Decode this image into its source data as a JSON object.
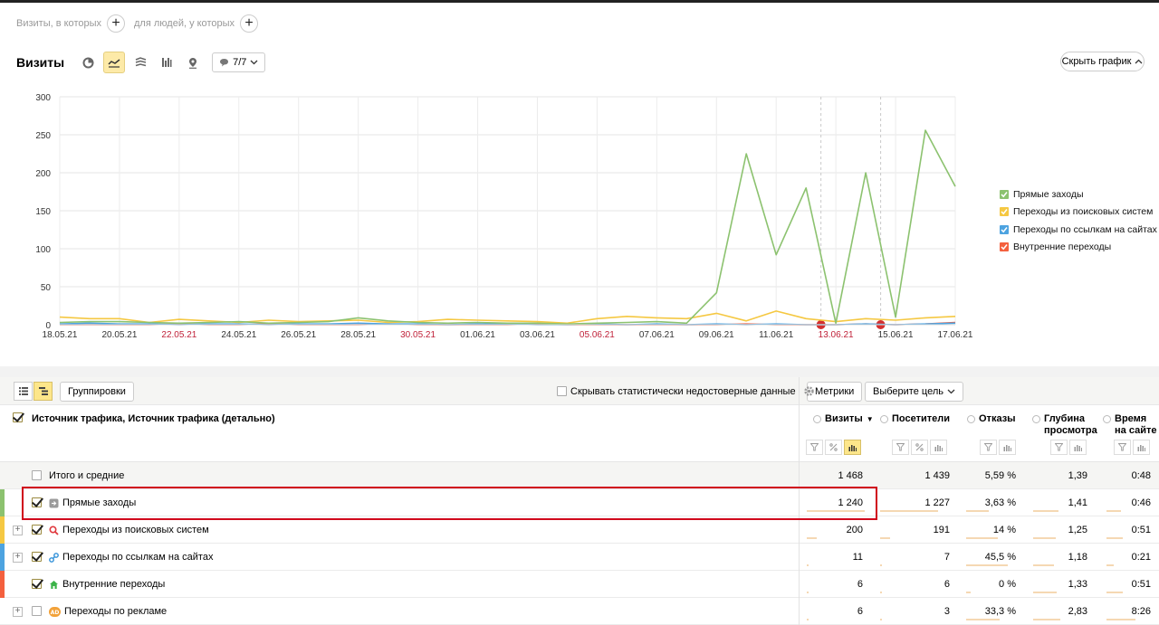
{
  "segment": {
    "visits_label": "Визиты, в которых",
    "people_label": "для людей, у которых"
  },
  "header": {
    "title": "Визиты",
    "detail_value": "7/7",
    "hide_chart_label": "Скрыть график"
  },
  "colors": {
    "direct": "#8cc26f",
    "search": "#f5c842",
    "links": "#4da3e0",
    "internal": "#f4603e",
    "ads": "#d0d0d0",
    "highlight": "#d0021b",
    "accent": "#fde68a"
  },
  "chart_data": {
    "type": "line",
    "x": [
      "18.05.21",
      "19.05.21",
      "20.05.21",
      "21.05.21",
      "22.05.21",
      "23.05.21",
      "24.05.21",
      "25.05.21",
      "26.05.21",
      "27.05.21",
      "28.05.21",
      "29.05.21",
      "30.05.21",
      "31.05.21",
      "01.06.21",
      "02.06.21",
      "03.06.21",
      "04.06.21",
      "05.06.21",
      "06.06.21",
      "07.06.21",
      "08.06.21",
      "09.06.21",
      "10.06.21",
      "11.06.21",
      "12.06.21",
      "13.06.21",
      "14.06.21",
      "15.06.21",
      "16.06.21",
      "17.06.21"
    ],
    "x_tick_labels": [
      "18.05.21",
      "20.05.21",
      "22.05.21",
      "24.05.21",
      "26.05.21",
      "28.05.21",
      "30.05.21",
      "01.06.21",
      "03.06.21",
      "05.06.21",
      "07.06.21",
      "09.06.21",
      "11.06.21",
      "13.06.21",
      "15.06.21",
      "17.06.21"
    ],
    "holiday_ticks": [
      "22.05.21",
      "30.05.21",
      "05.06.21",
      "13.06.21"
    ],
    "ylim": [
      0,
      300
    ],
    "yticks": [
      0,
      50,
      100,
      150,
      200,
      250,
      300
    ],
    "grid": true,
    "legend_position": "right",
    "series": [
      {
        "name": "Прямые заходы",
        "color": "#8cc26f",
        "values": [
          3,
          4,
          4,
          3,
          2,
          3,
          4,
          2,
          3,
          4,
          9,
          5,
          3,
          2,
          3,
          2,
          2,
          1,
          2,
          3,
          4,
          2,
          42,
          225,
          92,
          180,
          2,
          200,
          10,
          256,
          182
        ]
      },
      {
        "name": "Переходы из поисковых систем",
        "color": "#f5c842",
        "values": [
          10,
          8,
          8,
          3,
          7,
          5,
          3,
          6,
          4,
          5,
          6,
          3,
          4,
          7,
          6,
          5,
          4,
          2,
          8,
          11,
          9,
          8,
          15,
          5,
          18,
          8,
          4,
          8,
          6,
          9,
          11
        ]
      },
      {
        "name": "Переходы по ссылкам на сайтах",
        "color": "#4da3e0",
        "values": [
          1,
          2,
          1,
          1,
          0,
          1,
          1,
          0,
          1,
          1,
          2,
          1,
          1,
          0,
          1,
          1,
          0,
          0,
          1,
          0,
          1,
          0,
          1,
          0,
          1,
          0,
          0,
          1,
          0,
          1,
          2
        ]
      },
      {
        "name": "Внутренние переходы",
        "color": "#f4603e",
        "values": [
          0,
          0,
          0,
          0,
          1,
          0,
          0,
          1,
          0,
          0,
          0,
          1,
          0,
          0,
          0,
          0,
          1,
          0,
          0,
          0,
          0,
          0,
          0,
          1,
          0,
          0,
          0,
          1,
          0,
          1,
          3
        ]
      }
    ],
    "event_markers": [
      "13.06.21",
      "15.06.21"
    ]
  },
  "toolbar": {
    "groupings_label": "Группировки",
    "hide_unreliable_label": "Скрывать статистически недостоверные данные",
    "metrics_label": "Метрики",
    "goal_label": "Выберите цель"
  },
  "table": {
    "dimension_header": "Источник трафика, Источник трафика (детально)",
    "columns": [
      {
        "label": "Визиты",
        "sort": "▼"
      },
      {
        "label": "Посетители"
      },
      {
        "label": "Отказы"
      },
      {
        "label_line1": "Глубина",
        "label_line2": "просмотра"
      },
      {
        "label_line1": "Время",
        "label_line2": "на сайте"
      }
    ],
    "total": {
      "label": "Итого и средние",
      "visits": "1 468",
      "visitors": "1 439",
      "bounce": "5,59 %",
      "depth": "1,39",
      "time": "0:48"
    },
    "rows": [
      {
        "label": "Прямые заходы",
        "visits": "1 240",
        "visitors": "1 227",
        "bounce": "3,63 %",
        "depth": "1,41",
        "time": "0:46",
        "checked": true,
        "share": 0.845
      },
      {
        "label": "Переходы из поисковых систем",
        "visits": "200",
        "visitors": "191",
        "bounce": "14 %",
        "depth": "1,25",
        "time": "0:51",
        "checked": true,
        "share": 0.14
      },
      {
        "label": "Переходы по ссылкам на сайтах",
        "visits": "11",
        "visitors": "7",
        "bounce": "45,5 %",
        "depth": "1,18",
        "time": "0:21",
        "checked": true,
        "share": 0.02
      },
      {
        "label": "Внутренние переходы",
        "visits": "6",
        "visitors": "6",
        "bounce": "0 %",
        "depth": "1,33",
        "time": "0:51",
        "checked": true,
        "share": 0.01
      },
      {
        "label": "Переходы по рекламе",
        "visits": "6",
        "visitors": "3",
        "bounce": "33,3 %",
        "depth": "2,83",
        "time": "8:26",
        "checked": false,
        "share": 0.01
      }
    ]
  }
}
